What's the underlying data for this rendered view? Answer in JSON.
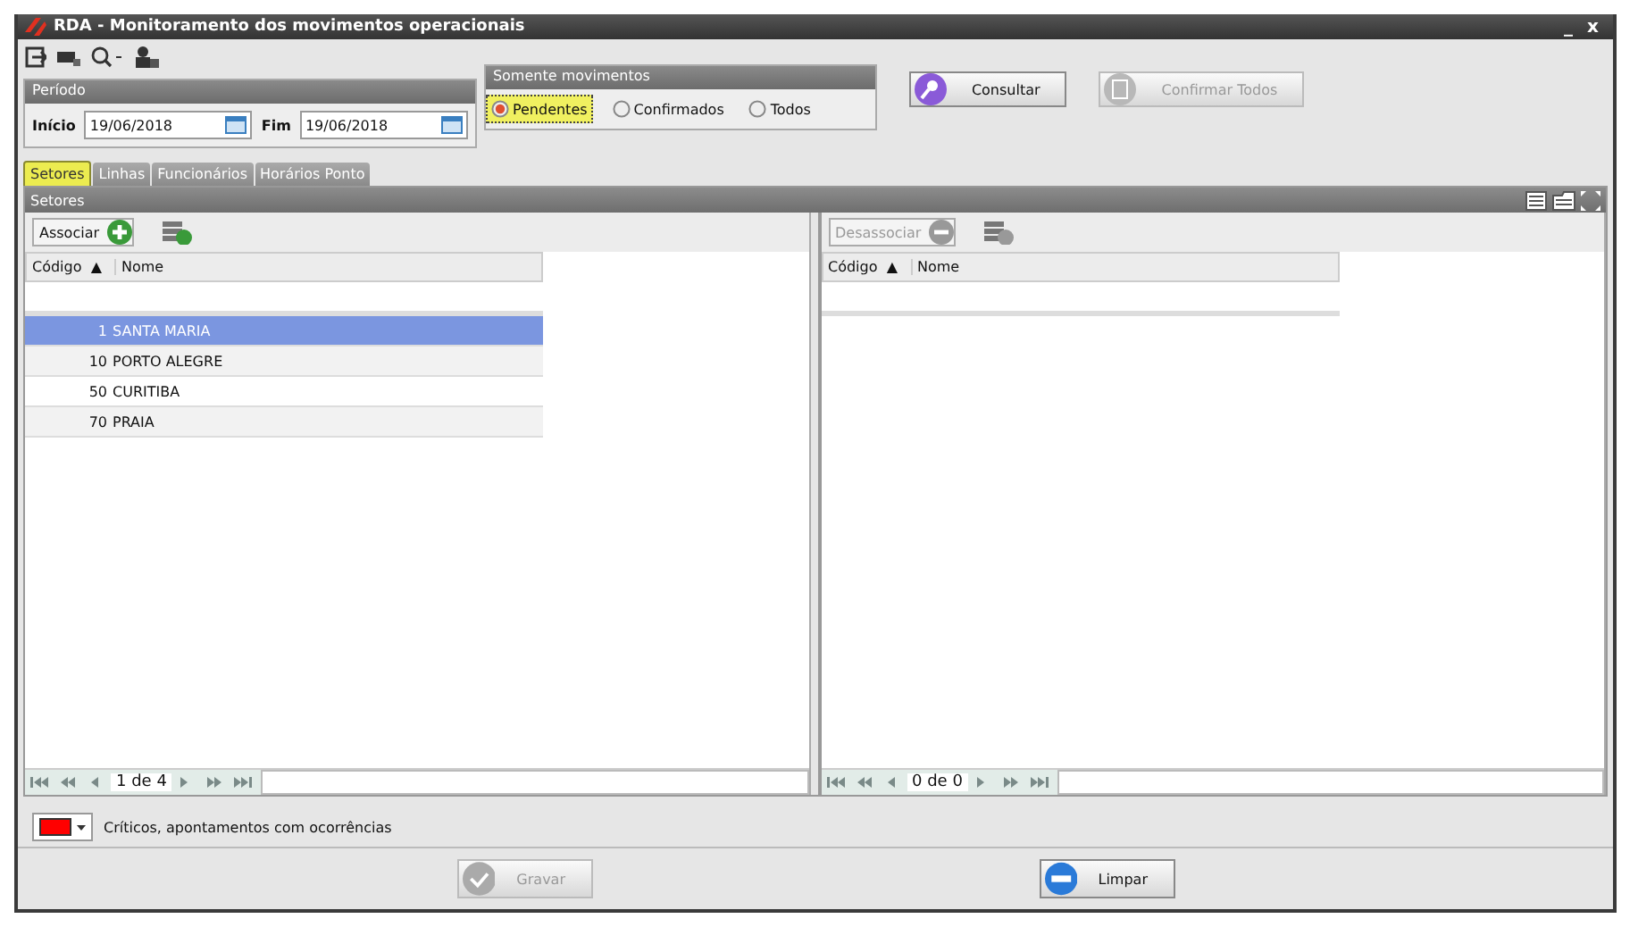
{
  "window": {
    "title": "RDA - Monitoramento dos movimentos operacionais",
    "minimize": "_",
    "close": "x"
  },
  "period": {
    "title": "Período",
    "start_label": "Início",
    "start_value": "19/06/2018",
    "end_label": "Fim",
    "end_value": "19/06/2018"
  },
  "movements": {
    "title": "Somente movimentos",
    "options": [
      {
        "label": "Pendentes",
        "selected": true
      },
      {
        "label": "Confirmados",
        "selected": false
      },
      {
        "label": "Todos",
        "selected": false
      }
    ]
  },
  "actions": [
    {
      "label": "Consultar",
      "kind": "search",
      "disabled": false
    },
    {
      "label": "Confirmar Todos",
      "kind": "confirm",
      "disabled": true
    }
  ],
  "tabs": [
    {
      "label": "Setores",
      "selected": true
    },
    {
      "label": "Linhas",
      "selected": false
    },
    {
      "label": "Funcionários",
      "selected": false
    },
    {
      "label": "Horários Ponto",
      "selected": false
    }
  ],
  "panel": {
    "title": "Setores"
  },
  "grids": [
    {
      "button": {
        "label": "Associar",
        "kind": "add",
        "disabled": false
      },
      "columns": [
        {
          "label": "Código",
          "sort_mark": "▲"
        },
        {
          "label": "Nome"
        }
      ],
      "rows": [
        {
          "code": "1",
          "name": "SANTA MARIA",
          "selected": true
        },
        {
          "code": "10",
          "name": "PORTO ALEGRE",
          "selected": false
        },
        {
          "code": "50",
          "name": "CURITIBA",
          "selected": false
        },
        {
          "code": "70",
          "name": "PRAIA",
          "selected": false
        }
      ],
      "pager": "1 de 4"
    },
    {
      "button": {
        "label": "Desassociar",
        "kind": "remove",
        "disabled": true
      },
      "columns": [
        {
          "label": "Código",
          "sort_mark": "▲"
        },
        {
          "label": "Nome"
        }
      ],
      "pager": "0 de 0"
    }
  ],
  "legend": {
    "color": "#ff0000",
    "text": "Críticos, apontamentos com ocorrências"
  },
  "footer_buttons": [
    {
      "label": "Gravar",
      "kind": "save",
      "disabled": true
    },
    {
      "label": "Limpar",
      "kind": "clear",
      "disabled": false
    }
  ]
}
